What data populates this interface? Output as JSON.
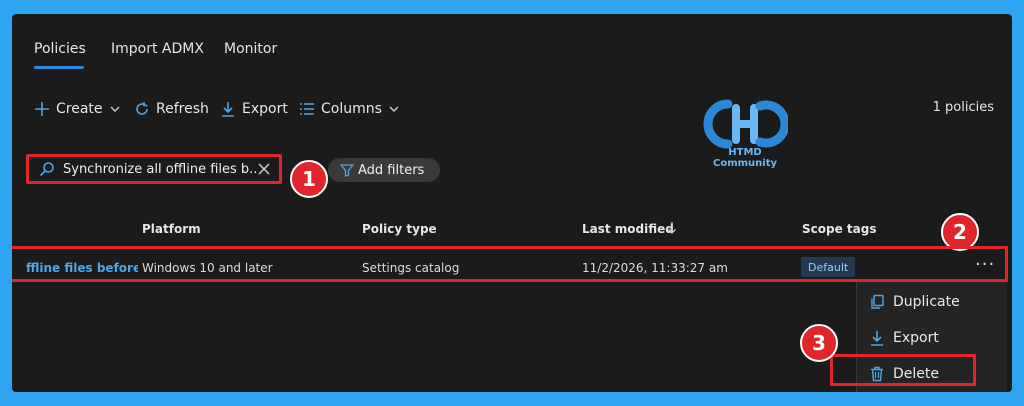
{
  "tabs": [
    {
      "label": "Policies",
      "active": true
    },
    {
      "label": "Import ADMX",
      "active": false
    },
    {
      "label": "Monitor",
      "active": false
    }
  ],
  "toolbar": {
    "create_label": "Create",
    "refresh_label": "Refresh",
    "export_label": "Export",
    "columns_label": "Columns",
    "policy_count": "1 policies"
  },
  "watermark": {
    "text": "HTMD Community"
  },
  "search": {
    "value": "Synchronize all offline files b..."
  },
  "filters": {
    "add_label": "Add filters"
  },
  "annotations": {
    "step1": "1",
    "step2": "2",
    "step3": "3"
  },
  "table": {
    "headers": {
      "platform": "Platform",
      "policy_type": "Policy type",
      "last_modified": "Last modified",
      "scope_tags": "Scope tags"
    },
    "rows": [
      {
        "name": "ffline files before lo",
        "platform": "Windows 10 and later",
        "policy_type": "Settings catalog",
        "last_modified": "11/2/2026, 11:33:27 am",
        "scope_tag": "Default"
      }
    ]
  },
  "context_menu": {
    "items": [
      {
        "label": "Duplicate",
        "icon": "duplicate-icon"
      },
      {
        "label": "Export",
        "icon": "download-icon"
      },
      {
        "label": "Delete",
        "icon": "trash-icon"
      }
    ]
  },
  "colors": {
    "frame": "#2fa4f0",
    "panel": "#1b1b1b",
    "accent": "#2b88d8",
    "highlight": "#e0262b",
    "link": "#4ea6ea"
  }
}
